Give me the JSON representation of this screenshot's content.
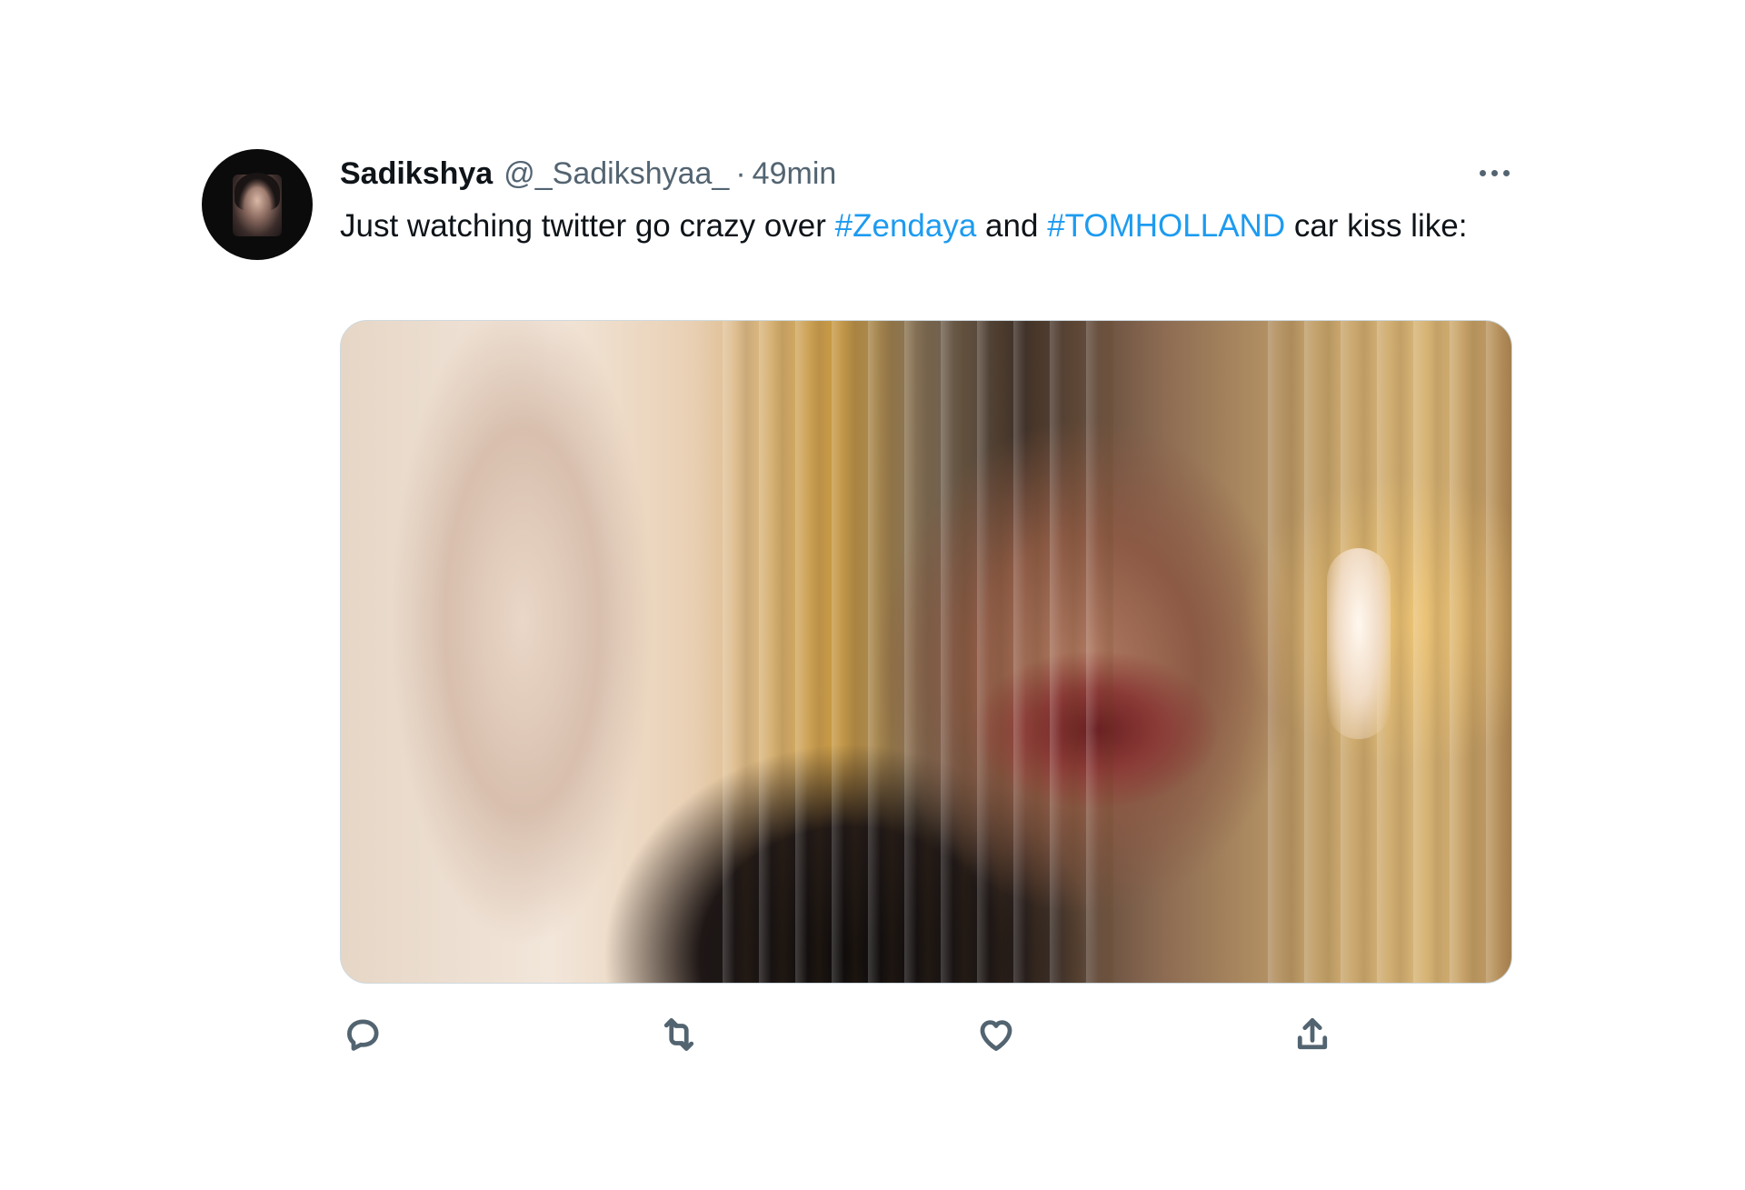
{
  "tweet": {
    "author_name": "Sadikshya",
    "author_handle": "@_Sadikshyaa_",
    "separator": "·",
    "timestamp": "49min",
    "text": {
      "part1": "Just watching twitter go crazy over ",
      "hashtag1": "#Zendaya",
      "part2": " and ",
      "hashtag2": "#TOMHOLLAND",
      "part3": " car kiss like:"
    }
  },
  "actions": {
    "icons": [
      "reply-icon",
      "retweet-icon",
      "like-icon",
      "share-icon"
    ]
  },
  "colors": {
    "text": "#0f1419",
    "muted": "#536471",
    "accent": "#1d9bf0",
    "background": "#ffffff"
  }
}
